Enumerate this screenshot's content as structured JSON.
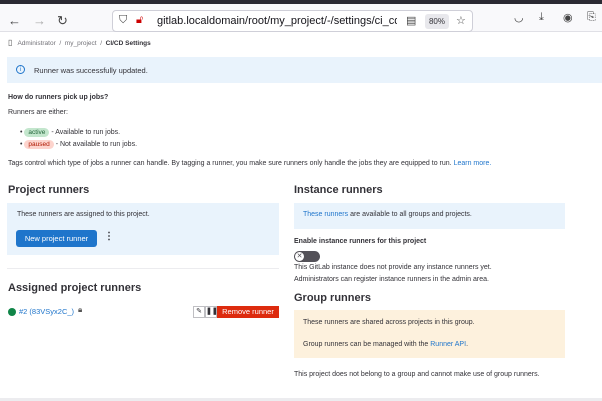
{
  "browser": {
    "url": "gitlab.localdomain/root/my_project/-/settings/ci_cd#",
    "zoom": "80%"
  },
  "breadcrumb": [
    "Administrator",
    "my_project",
    "CI/CD Settings"
  ],
  "alert": "Runner was successfully updated.",
  "help": {
    "title": "How do runners pick up jobs?",
    "intro": "Runners are either:",
    "states": [
      {
        "badge": "active",
        "desc": "- Available to run jobs.",
        "color": "#c3e6cd"
      },
      {
        "badge": "paused",
        "desc": "- Not available to run jobs.",
        "color": "#fdd4cd"
      }
    ],
    "tags_text": "Tags control which type of jobs a runner can handle. By tagging a runner, you make sure runners only handle the jobs they are equipped to run.",
    "learn_more": "Learn more."
  },
  "project_runners": {
    "title": "Project runners",
    "desc": "These runners are assigned to this project.",
    "new_button": "New project runner"
  },
  "assigned": {
    "title": "Assigned project runners",
    "runner": "#2 (83VSyx2C_)",
    "status_color": "#108548",
    "remove_button": "Remove runner"
  },
  "instance": {
    "title": "Instance runners",
    "link": "These runners",
    "desc": " are available to all groups and projects.",
    "toggle_label": "Enable instance runners for this project",
    "toggle_on": false,
    "note1": "This GitLab instance does not provide any instance runners yet.",
    "note2": "Administrators can register instance runners in the admin area."
  },
  "group": {
    "title": "Group runners",
    "line1": "These runners are shared across projects in this group.",
    "line2": "Group runners can be managed with the ",
    "api_link": "Runner API",
    "line2_end": ".",
    "note": "This project does not belong to a group and cannot make use of group runners."
  }
}
